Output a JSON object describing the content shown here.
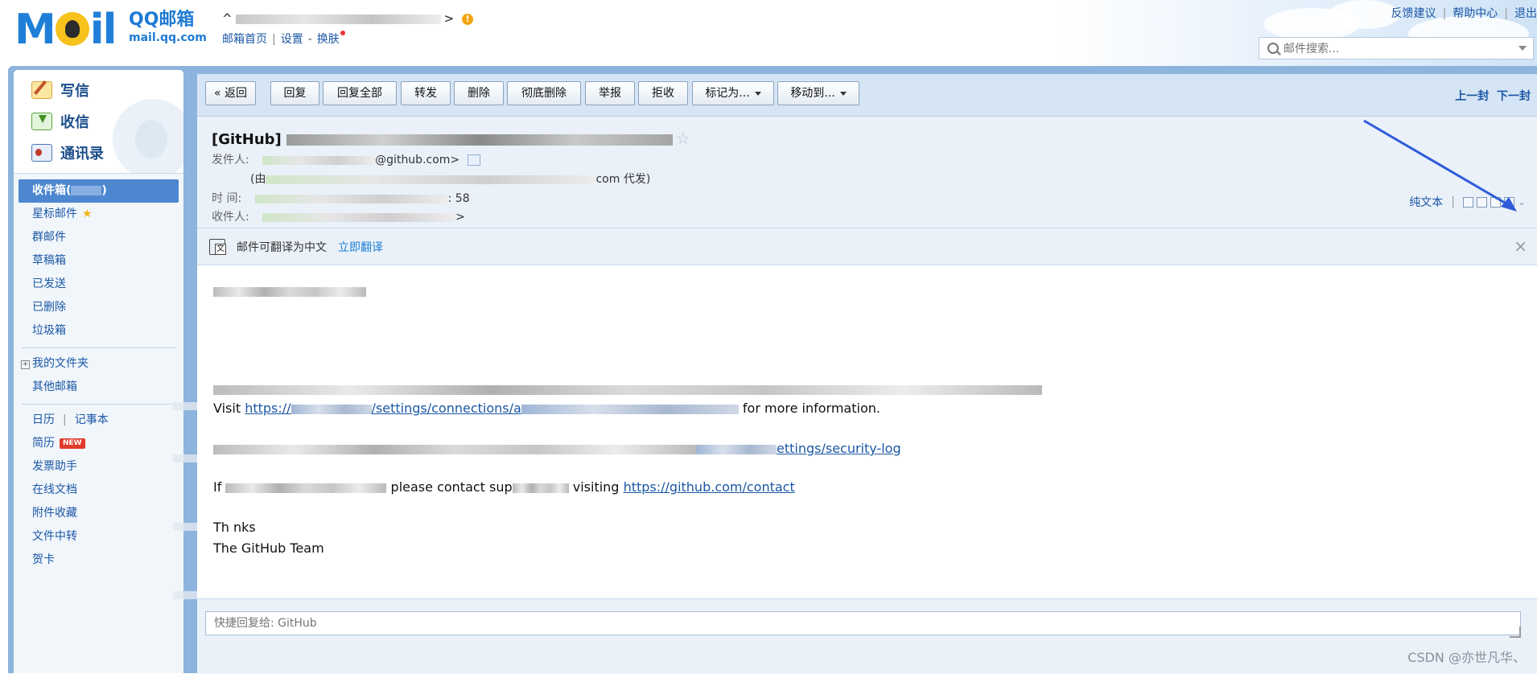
{
  "header": {
    "logo_word": "MOil",
    "brand": "QQ邮箱",
    "domain": "mail.qq.com",
    "account_prefix": "^",
    "account_suffix": ">",
    "links": [
      "邮箱首页",
      "设置",
      "换肤"
    ],
    "link_dash": "-",
    "top_links": [
      "反馈建议",
      "帮助中心",
      "退出"
    ],
    "search_placeholder": "邮件搜索..."
  },
  "sidebar": {
    "quick": [
      "写信",
      "收信",
      "通讯录"
    ],
    "inbox": "收件箱(",
    "inbox_suffix": ")",
    "folders": [
      "星标邮件",
      "群邮件",
      "草稿箱",
      "已发送",
      "已删除",
      "垃圾箱"
    ],
    "my_folders": "我的文件夹",
    "other_mail": "其他邮箱",
    "calendar": "日历",
    "notes": "记事本",
    "resume": "简历",
    "new_tag": "NEW",
    "apps": [
      "发票助手",
      "在线文档",
      "附件收藏",
      "文件中转",
      "贺卡"
    ]
  },
  "toolbar": {
    "back": "« 返回",
    "reply": "回复",
    "reply_all": "回复全部",
    "forward": "转发",
    "delete": "删除",
    "delete_forever": "彻底删除",
    "report": "举报",
    "reject": "拒收",
    "mark_as": "标记为...",
    "move_to": "移动到...",
    "prev": "上一封",
    "next": "下一封"
  },
  "mail": {
    "subject_start": "[GitHub]",
    "sender_label": "发件人:",
    "sender_domain": "@github.com>",
    "sender_via_start": "(由",
    "sender_via_end": "com 代发)",
    "time_label": "时   间:",
    "time_end": ": 58",
    "to_label": "收件人:",
    "to_end": ">",
    "plain_text": "纯文本",
    "translate_text": "邮件可翻译为中文",
    "translate_link": "立即翻译",
    "close": "×"
  },
  "body": {
    "line_visit": "Visit",
    "link_part1": "https://",
    "link_part2": "/settings/connections/a",
    "line_more": "for more information.",
    "link_security": "ettings/security-log",
    "line_if": "If",
    "line_if_mid": "please contact sup",
    "line_if_visiting": "visiting",
    "contact_link": "https://github.com/contact",
    "thanks": "Th   nks",
    "team": "The GitHub Team"
  },
  "quick_reply": {
    "placeholder": "快捷回复给: GitHub"
  },
  "watermark": "CSDN @亦世凡华、"
}
